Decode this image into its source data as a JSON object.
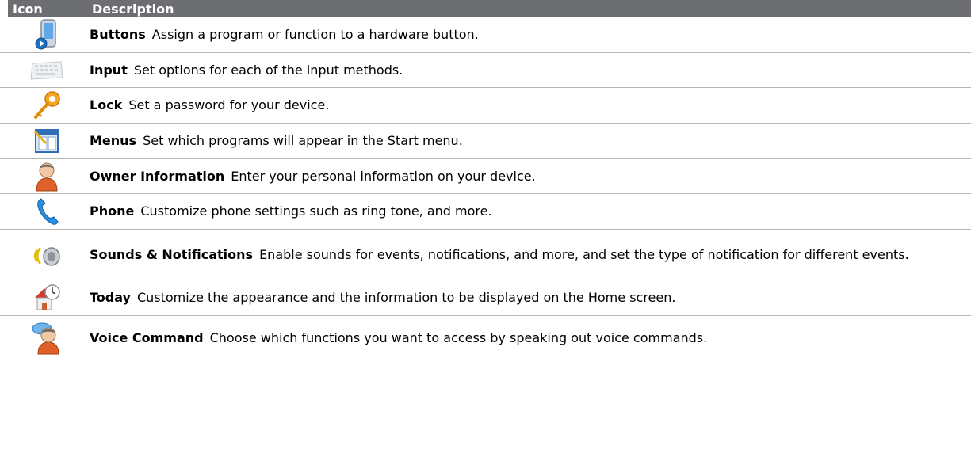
{
  "header": {
    "icon_col": "Icon",
    "desc_col": "Description"
  },
  "rows": [
    {
      "icon": "phone-buttons-icon",
      "title": "Buttons",
      "text": "Assign a program or function to a hardware button."
    },
    {
      "icon": "keyboard-icon",
      "title": "Input",
      "text": "Set options for each of the input methods."
    },
    {
      "icon": "key-icon",
      "title": "Lock",
      "text": "Set a password for your device."
    },
    {
      "icon": "menu-window-icon",
      "title": "Menus",
      "text": "Set which programs will appear in the Start menu."
    },
    {
      "icon": "person-icon",
      "title": "Owner Information",
      "text": "Enter your personal information on your device."
    },
    {
      "icon": "phone-handset-icon",
      "title": "Phone",
      "text": "Customize phone settings such as ring tone, and more."
    },
    {
      "icon": "speaker-icon",
      "title": "Sounds & Notifications",
      "text": "Enable sounds for events, notifications, and more, and set the type of notification for different events."
    },
    {
      "icon": "home-clock-icon",
      "title": "Today",
      "text": "Customize the appearance and the information to be displayed on the Home screen."
    },
    {
      "icon": "voice-person-icon",
      "title": "Voice Command",
      "text": "Choose which functions you want to access by speaking out voice commands."
    }
  ],
  "colors": {
    "header_bg": "#6d6e71",
    "divider": "#b5b5b5"
  }
}
